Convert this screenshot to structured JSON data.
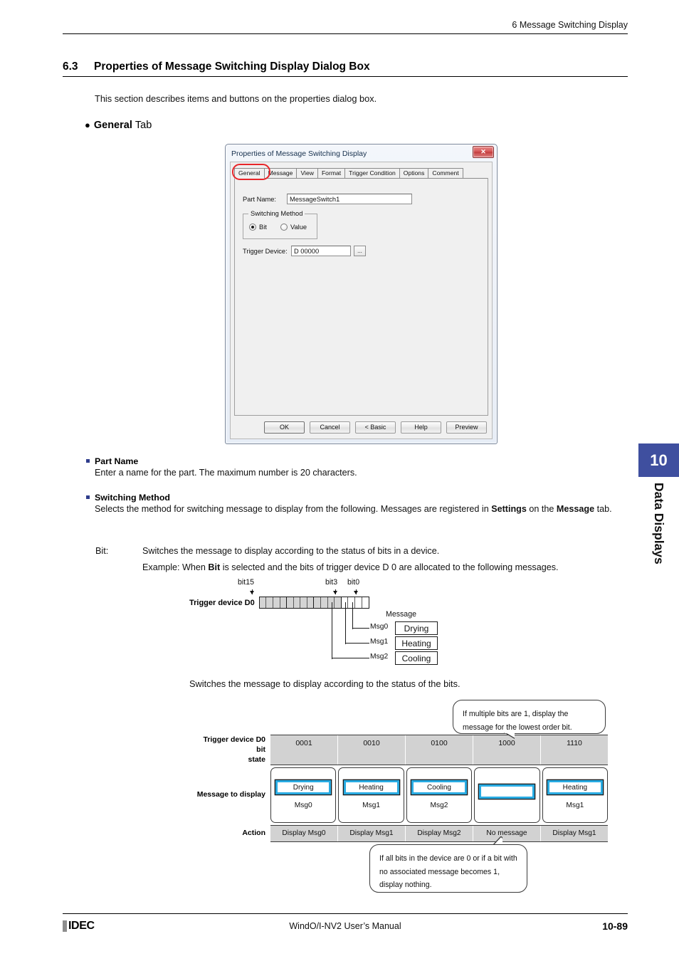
{
  "header": {
    "running_head": "6 Message Switching Display"
  },
  "section": {
    "number": "6.3",
    "title": "Properties of Message Switching Display Dialog Box",
    "intro": "This section describes items and buttons on the properties dialog box.",
    "tab_heading_bold": "General",
    "tab_heading_rest": "Tab",
    "bullet_glyph": "●"
  },
  "dialog": {
    "title": "Properties of Message Switching Display",
    "close_label": "✕",
    "tabs": [
      {
        "label": "General",
        "active": true
      },
      {
        "label": "Message",
        "active": false
      },
      {
        "label": "View",
        "active": false
      },
      {
        "label": "Format",
        "active": false
      },
      {
        "label": "Trigger Condition",
        "active": false
      },
      {
        "label": "Options",
        "active": false
      },
      {
        "label": "Comment",
        "active": false
      }
    ],
    "part_name_label": "Part Name:",
    "part_name_value": "MessageSwitch1",
    "switching_method_label": "Switching Method",
    "radio_bit": "Bit",
    "radio_value": "Value",
    "selected_method": "Bit",
    "trigger_device_label": "Trigger Device:",
    "trigger_device_value": "D 00000",
    "browse_label": "...",
    "buttons": [
      {
        "label": "OK",
        "default": true
      },
      {
        "label": "Cancel",
        "default": false
      },
      {
        "label": "< Basic",
        "default": false
      },
      {
        "label": "Help",
        "default": false
      },
      {
        "label": "Preview",
        "default": false
      }
    ]
  },
  "blocks": [
    {
      "title": "Part Name",
      "body": "Enter a name for the part. The maximum number is 20 characters."
    },
    {
      "title": "Switching Method",
      "body_1": "Selects the method for switching message to display from the following. Messages are registered in ",
      "body_bold_1": "Settings",
      "body_2": " on the ",
      "body_bold_2": "Message",
      "body_3": " tab."
    }
  ],
  "definitions": {
    "bit_term": "Bit:",
    "bit_desc": "Switches the message to display according to the status of bits in a device.",
    "example_pre": "Example: When ",
    "example_bold": "Bit",
    "example_post": " is selected and the bits of trigger device D 0 are allocated to the following messages."
  },
  "bit_diagram": {
    "label_bit15": "bit15",
    "label_bit3": "bit3",
    "label_bit0": "bit0",
    "register_label": "Trigger device D0",
    "message_header": "Message",
    "rows": [
      {
        "tag": "Msg0",
        "message": "Drying"
      },
      {
        "tag": "Msg1",
        "message": "Heating"
      },
      {
        "tag": "Msg2",
        "message": "Cooling"
      }
    ]
  },
  "mid_text": "Switches the message to display according to the status of the bits.",
  "table_diagram": {
    "row_labels": {
      "state": "Trigger device D0 bit\nstate",
      "state_line1": "Trigger device D0 bit",
      "state_line2": "state",
      "display": "Message to display",
      "action": "Action"
    },
    "columns": [
      {
        "state": "0001",
        "message": "Drying",
        "tag": "Msg0",
        "action": "Display Msg0"
      },
      {
        "state": "0010",
        "message": "Heating",
        "tag": "Msg1",
        "action": "Display Msg1"
      },
      {
        "state": "0100",
        "message": "Cooling",
        "tag": "Msg2",
        "action": "Display Msg2"
      },
      {
        "state": "1000",
        "message": "",
        "tag": "",
        "action": "No message"
      },
      {
        "state": "1110",
        "message": "Heating",
        "tag": "Msg1",
        "action": "Display Msg1"
      }
    ],
    "callout_top": "If multiple bits are 1, display the message for the lowest order bit.",
    "callout_bottom": "If all bits in the device are 0 or if a bit with no associated message becomes 1, display nothing."
  },
  "side_tab": {
    "number": "10",
    "label": "Data Displays",
    "color": "#3f4f9f"
  },
  "footer": {
    "logo": "IDEC",
    "manual": "WindO/I-NV2 User’s Manual",
    "page": "10-89"
  },
  "colors": {
    "accent_blue": "#3f4f9f",
    "lcd_cyan": "#29abe2",
    "highlight_red": "#e8262a",
    "bullet_square": "#2f3d8c"
  }
}
